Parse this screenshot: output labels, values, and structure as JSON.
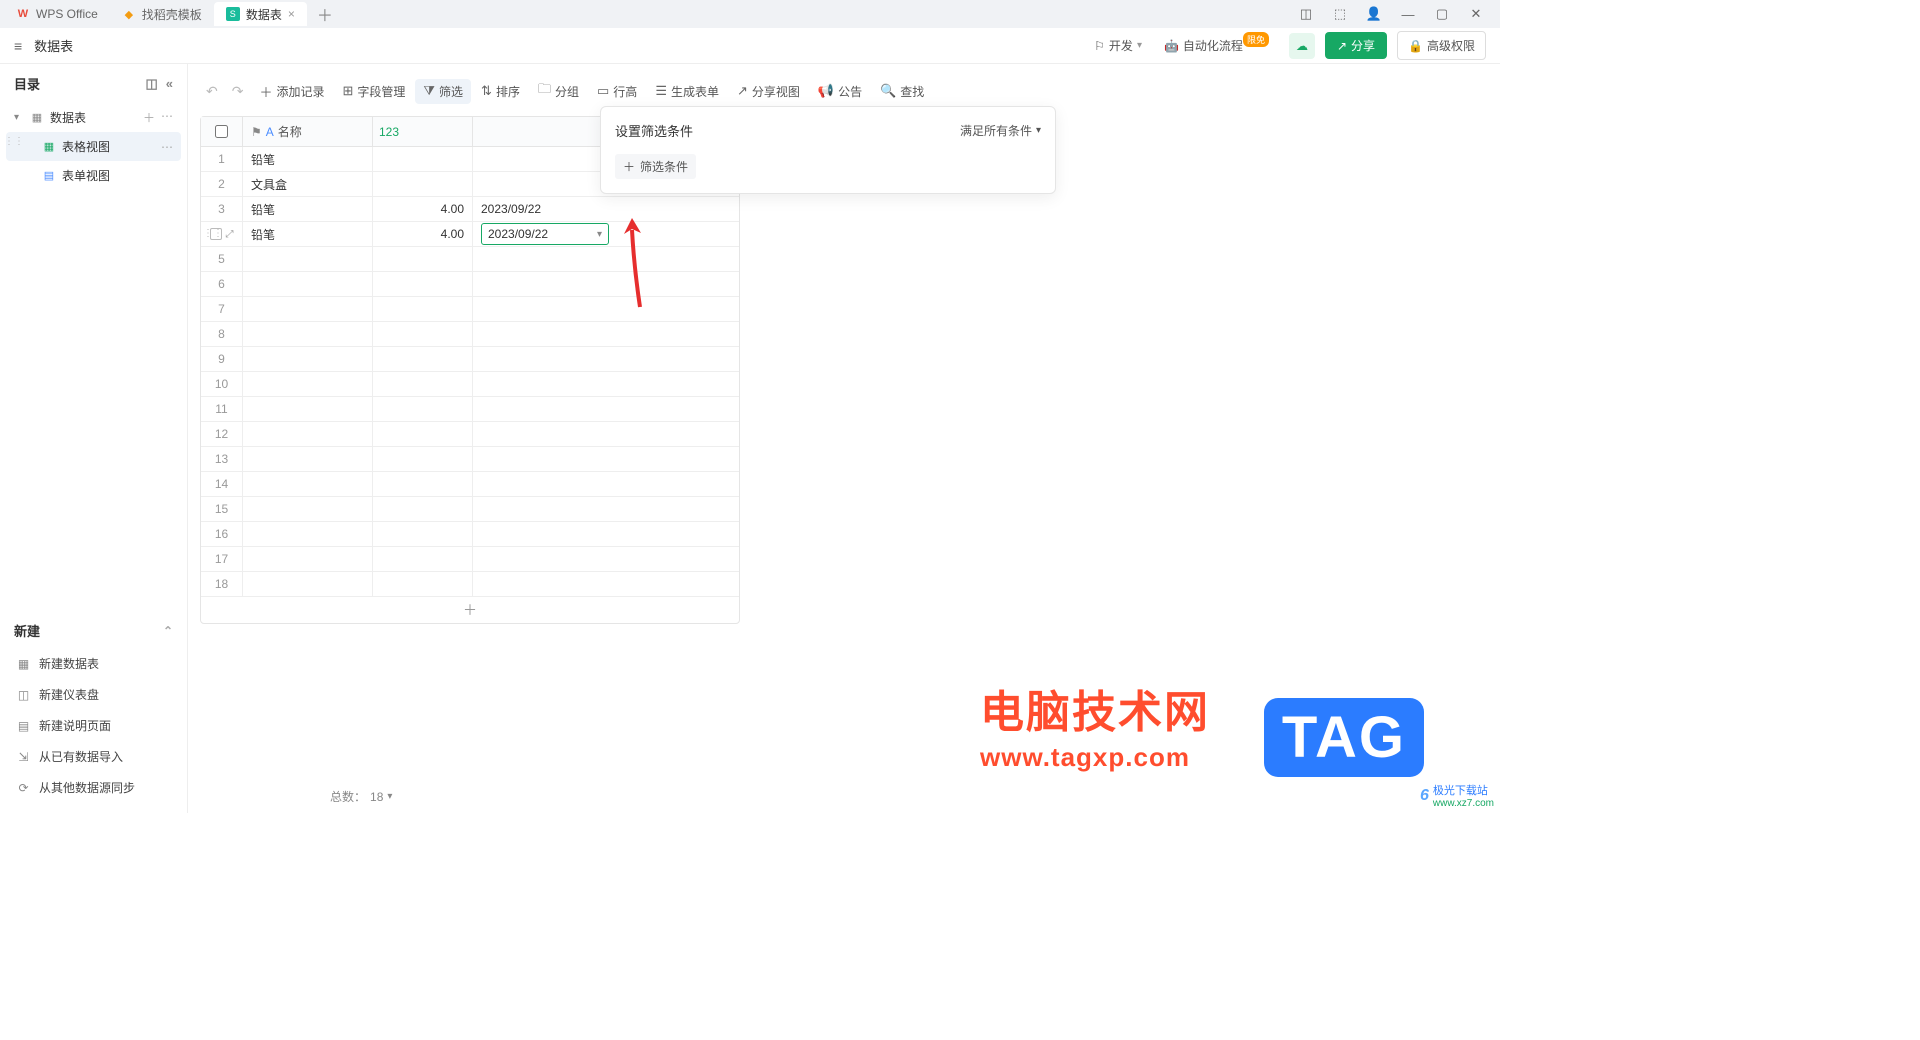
{
  "tabs": [
    {
      "label": "WPS Office",
      "iconClass": "red",
      "iconGlyph": "W"
    },
    {
      "label": "找稻壳模板",
      "iconClass": "orange",
      "iconGlyph": "◆"
    },
    {
      "label": "数据表",
      "iconClass": "green",
      "iconGlyph": "S",
      "active": true
    }
  ],
  "docTitle": "数据表",
  "subheader": {
    "dev": "开发",
    "auto": "自动化流程",
    "autoBadge": "限免",
    "share": "分享",
    "perm": "高级权限"
  },
  "sidebar": {
    "title": "目录",
    "root": "数据表",
    "views": [
      {
        "label": "表格视图",
        "icon": "grid",
        "active": true
      },
      {
        "label": "表单视图",
        "icon": "form"
      }
    ],
    "newTitle": "新建",
    "newItems": [
      {
        "icon": "▦",
        "label": "新建数据表"
      },
      {
        "icon": "◫",
        "label": "新建仪表盘"
      },
      {
        "icon": "▤",
        "label": "新建说明页面"
      },
      {
        "icon": "⇲",
        "label": "从已有数据导入"
      },
      {
        "icon": "⟳",
        "label": "从其他数据源同步"
      }
    ]
  },
  "toolbar": {
    "addRecord": "添加记录",
    "fieldMgr": "字段管理",
    "filter": "筛选",
    "sort": "排序",
    "group": "分组",
    "rowHeight": "行高",
    "genForm": "生成表单",
    "shareView": "分享视图",
    "notice": "公告",
    "search": "查找"
  },
  "table": {
    "nameHeader": "名称",
    "rows": [
      {
        "n": 1,
        "name": "铅笔",
        "num": "",
        "date": ""
      },
      {
        "n": 2,
        "name": "文具盒",
        "num": "",
        "date": ""
      },
      {
        "n": 3,
        "name": "铅笔",
        "num": "4.00",
        "date": "2023/09/22"
      },
      {
        "n": 4,
        "name": "铅笔",
        "num": "4.00",
        "date": "2023/09/22",
        "editing": true
      }
    ],
    "emptyRows": [
      5,
      6,
      7,
      8,
      9,
      10,
      11,
      12,
      13,
      14,
      15,
      16,
      17,
      18
    ]
  },
  "filterPop": {
    "title": "设置筛选条件",
    "condMode": "满足所有条件",
    "addCond": "筛选条件"
  },
  "footer": {
    "totalLabel": "总数：",
    "totalValue": "18"
  },
  "watermark": {
    "cn": "电脑技术网",
    "url": "www.tagxp.com",
    "tag": "TAG",
    "site1": "极光下载站",
    "site2": "www.xz7.com"
  }
}
